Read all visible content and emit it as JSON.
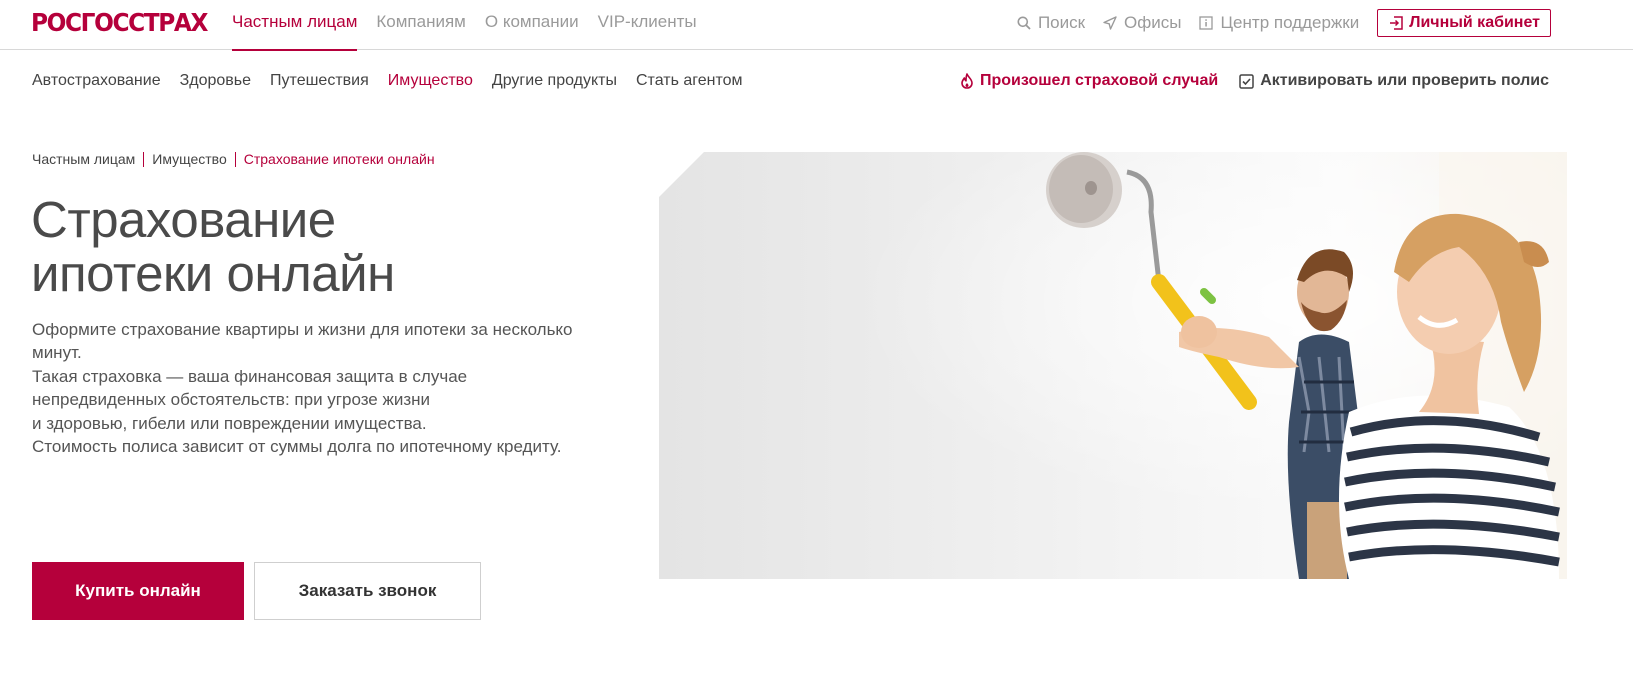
{
  "brand": {
    "name": "РОСГОССТРАХ",
    "color": "#b5003b"
  },
  "topnav": {
    "items": [
      {
        "label": "Частным лицам",
        "active": true
      },
      {
        "label": "Компаниям",
        "active": false
      },
      {
        "label": "О компании",
        "active": false
      },
      {
        "label": "VIP-клиенты",
        "active": false
      }
    ]
  },
  "topright": {
    "search": {
      "label": "Поиск",
      "icon": "search-icon"
    },
    "offices": {
      "label": "Офисы",
      "icon": "location-arrow-icon"
    },
    "support": {
      "label": "Центр поддержки",
      "icon": "info-icon"
    },
    "cabinet": {
      "label": "Личный кабинет",
      "icon": "login-icon"
    }
  },
  "subnav": {
    "items": [
      {
        "label": "Автострахование",
        "active": false
      },
      {
        "label": "Здоровье",
        "active": false
      },
      {
        "label": "Путешествия",
        "active": false
      },
      {
        "label": "Имущество",
        "active": true
      },
      {
        "label": "Другие продукты",
        "active": false
      },
      {
        "label": "Стать агентом",
        "active": false
      }
    ],
    "claim": {
      "label": "Произошел страховой случай",
      "icon": "fire-icon"
    },
    "check": {
      "label": "Активировать или проверить полис",
      "icon": "checkbox-icon"
    }
  },
  "breadcrumb": {
    "items": [
      "Частным лицам",
      "Имущество"
    ],
    "current": "Страхование ипотеки онлайн"
  },
  "hero": {
    "title_line1": "Страхование",
    "title_line2": "ипотеки онлайн",
    "description": [
      "Оформите страхование квартиры и жизни для ипотеки за несколько минут.",
      "Такая страховка — ваша финансовая защита в случае непредвиденных обстоятельств: при угрозе жизни",
      "и здоровью, гибели или повреждении имущества.",
      "Стоимость полиса зависит от суммы долга по ипотечному кредиту."
    ],
    "buy_button": "Купить онлайн",
    "call_button": "Заказать звонок"
  },
  "colors": {
    "accent": "#b5003b",
    "text": "#444444",
    "muted": "#9a9a9a"
  }
}
